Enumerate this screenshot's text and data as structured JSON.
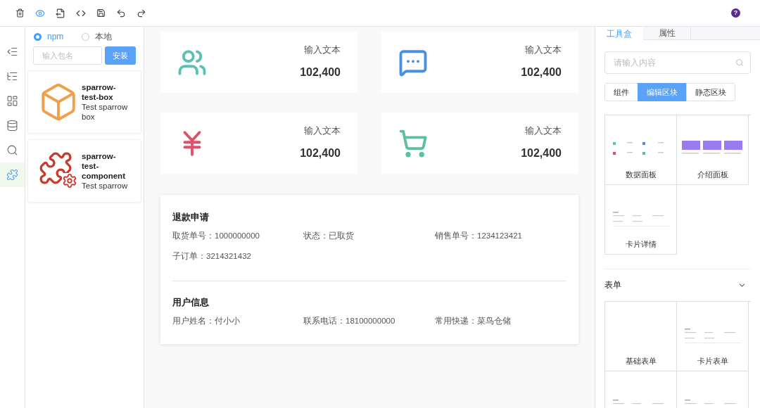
{
  "toolbar": {
    "help": "?"
  },
  "rail": [
    {
      "kind": "outdent",
      "selected": false
    },
    {
      "kind": "tree",
      "selected": false
    },
    {
      "kind": "layout",
      "selected": false
    },
    {
      "kind": "database",
      "selected": false
    },
    {
      "kind": "search",
      "selected": false
    },
    {
      "kind": "plugin",
      "selected": true
    }
  ],
  "packages": {
    "sources": [
      {
        "label": "npm",
        "selected": true
      },
      {
        "label": "本地",
        "selected": false
      }
    ],
    "input": {
      "placeholder": "输入包名"
    },
    "install_button": "安装",
    "items": [
      {
        "kind": "box",
        "name": "sparrow-test-box",
        "description": "Test sparrow box"
      },
      {
        "kind": "plugin",
        "name": "sparrow-test-component",
        "description": "Test sparrow"
      }
    ]
  },
  "stats": [
    {
      "kind": "users",
      "label": "输入文本",
      "value": "102,400"
    },
    {
      "kind": "chat",
      "label": "输入文本",
      "value": "102,400"
    },
    {
      "kind": "yen",
      "label": "输入文本",
      "value": "102,400"
    },
    {
      "kind": "cart",
      "label": "输入文本",
      "value": "102,400"
    }
  ],
  "detail": [
    {
      "title": "退款申请",
      "fields": [
        {
          "label": "取货单号：",
          "value": "1000000000"
        },
        {
          "label": "状态：",
          "value": "已取货"
        },
        {
          "label": "销售单号：",
          "value": "1234123421"
        },
        {
          "label": "子订单：",
          "value": "3214321432"
        }
      ]
    },
    {
      "title": "用户信息",
      "fields": [
        {
          "label": "用户姓名：",
          "value": "付小小"
        },
        {
          "label": "联系电话：",
          "value": "18100000000"
        },
        {
          "label": "常用快递：",
          "value": "菜鸟仓储"
        }
      ]
    }
  ],
  "panel": {
    "tabs": [
      {
        "label": "工具盒",
        "selected": true
      },
      {
        "label": "属性",
        "selected": false
      }
    ],
    "search": {
      "placeholder": "请输入内容"
    },
    "segments": [
      {
        "label": "组件",
        "selected": false
      },
      {
        "label": "编辑区块",
        "selected": true
      },
      {
        "label": "静态区块",
        "selected": false
      }
    ],
    "groups": [
      {
        "blocks": [
          {
            "kind": "stats",
            "label": "数据面板"
          },
          {
            "kind": "intro",
            "label": "介绍面板"
          },
          {
            "kind": "detail",
            "label": "卡片详情"
          }
        ]
      },
      {
        "title": "表单",
        "expanded": true,
        "blocks": [
          {
            "kind": "blank",
            "label": "基础表单"
          },
          {
            "kind": "form",
            "label": "卡片表单"
          },
          {
            "kind": "lines"
          },
          {
            "kind": "lines"
          }
        ]
      }
    ]
  }
}
